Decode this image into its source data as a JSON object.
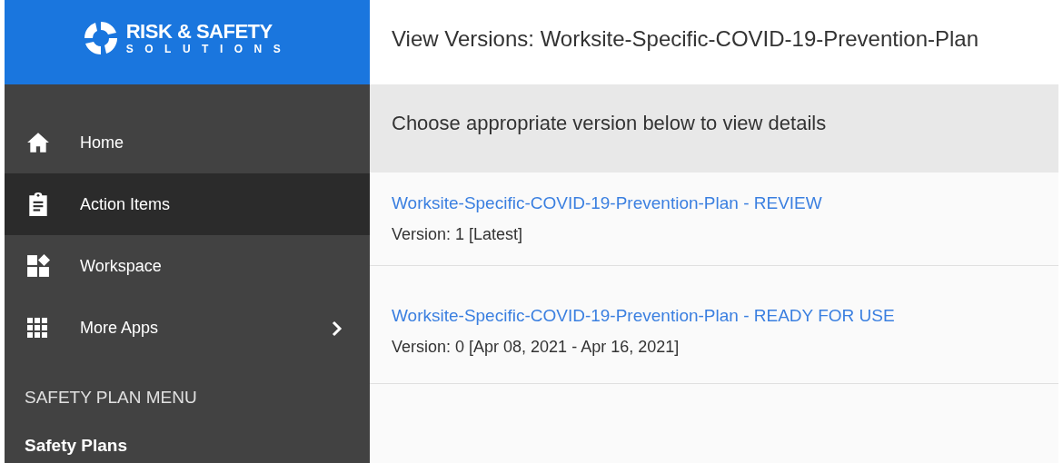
{
  "logo": {
    "line1": "RISK & SAFETY",
    "line2": "SOLUTIONS"
  },
  "sidebar": {
    "items": [
      {
        "label": "Home",
        "selected": false,
        "submenu": false
      },
      {
        "label": "Action Items",
        "selected": true,
        "submenu": false
      },
      {
        "label": "Workspace",
        "selected": false,
        "submenu": false
      },
      {
        "label": "More Apps",
        "selected": false,
        "submenu": true
      }
    ],
    "section_title": "SAFETY PLAN MENU",
    "section_items": [
      "Safety Plans"
    ]
  },
  "page_title": "View Versions: Worksite-Specific-COVID-19-Prevention-Plan",
  "instruction": "Choose appropriate version below to view details",
  "versions": [
    {
      "link": "Worksite-Specific-COVID-19-Prevention-Plan - REVIEW",
      "detail": "Version: 1 [Latest]"
    },
    {
      "link": "Worksite-Specific-COVID-19-Prevention-Plan - READY FOR USE",
      "detail": "Version: 0 [Apr 08, 2021 - Apr 16, 2021]"
    }
  ]
}
